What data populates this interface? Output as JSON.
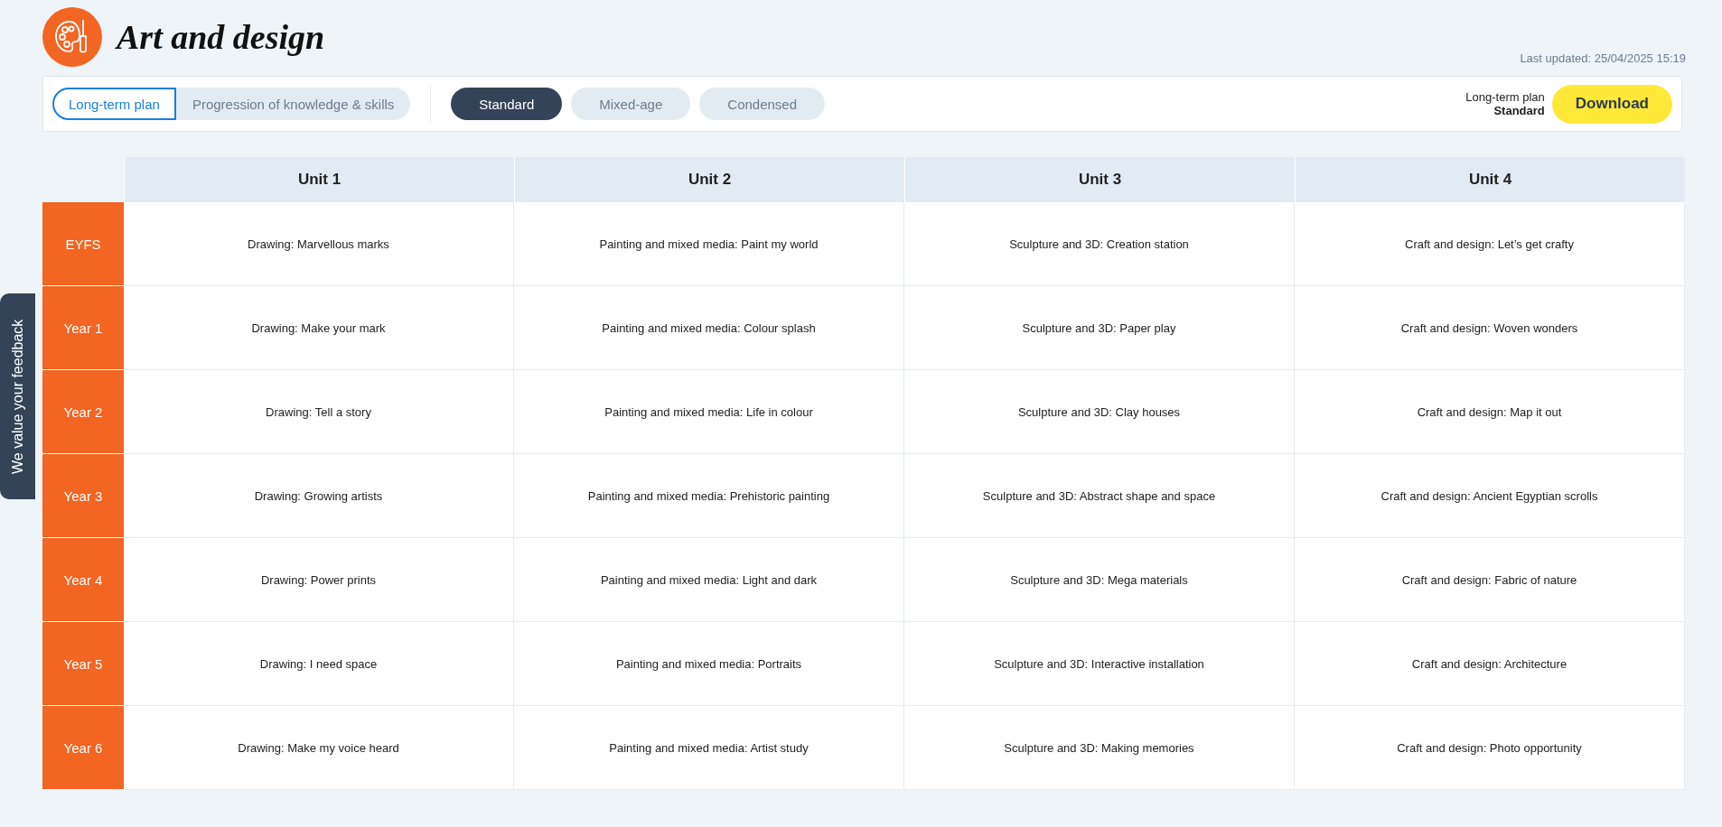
{
  "header": {
    "title": "Art and design",
    "last_updated": "Last updated: 25/04/2025 15:19"
  },
  "plan_tabs": [
    {
      "label": "Long-term plan",
      "selected": true
    },
    {
      "label": "Progression of knowledge & skills",
      "selected": false
    }
  ],
  "variant_tabs": [
    {
      "label": "Standard",
      "selected": true
    },
    {
      "label": "Mixed-age",
      "selected": false
    },
    {
      "label": "Condensed",
      "selected": false
    }
  ],
  "download": {
    "plan": "Long-term plan",
    "variant": "Standard",
    "button": "Download"
  },
  "feedback_tab": "We value your feedback",
  "table": {
    "columns": [
      "Unit 1",
      "Unit 2",
      "Unit 3",
      "Unit 4"
    ],
    "rows": [
      {
        "label": "EYFS",
        "cells": [
          "Drawing: Marvellous marks",
          "Painting and mixed media: Paint my world",
          "Sculpture and 3D: Creation station",
          "Craft and design: Let’s get crafty"
        ]
      },
      {
        "label": "Year 1",
        "cells": [
          "Drawing: Make your mark",
          "Painting and mixed media: Colour splash",
          "Sculpture and 3D: Paper play",
          "Craft and design: Woven wonders"
        ]
      },
      {
        "label": "Year 2",
        "cells": [
          "Drawing: Tell a story",
          "Painting and mixed media: Life in colour",
          "Sculpture and 3D: Clay houses",
          "Craft and design: Map it out"
        ]
      },
      {
        "label": "Year 3",
        "cells": [
          "Drawing: Growing artists",
          "Painting and mixed media: Prehistoric painting",
          "Sculpture and 3D: Abstract shape and space",
          "Craft and design: Ancient Egyptian scrolls"
        ]
      },
      {
        "label": "Year 4",
        "cells": [
          "Drawing: Power prints",
          "Painting and mixed media: Light and dark",
          "Sculpture and 3D: Mega materials",
          "Craft and design: Fabric of nature"
        ]
      },
      {
        "label": "Year 5",
        "cells": [
          "Drawing: I need space",
          "Painting and mixed media: Portraits",
          "Sculpture and 3D: Interactive installation",
          "Craft and design: Architecture"
        ]
      },
      {
        "label": "Year 6",
        "cells": [
          "Drawing: Make my voice heard",
          "Painting and mixed media: Artist study",
          "Sculpture and 3D: Making memories",
          "Craft and design: Photo opportunity"
        ]
      }
    ]
  }
}
